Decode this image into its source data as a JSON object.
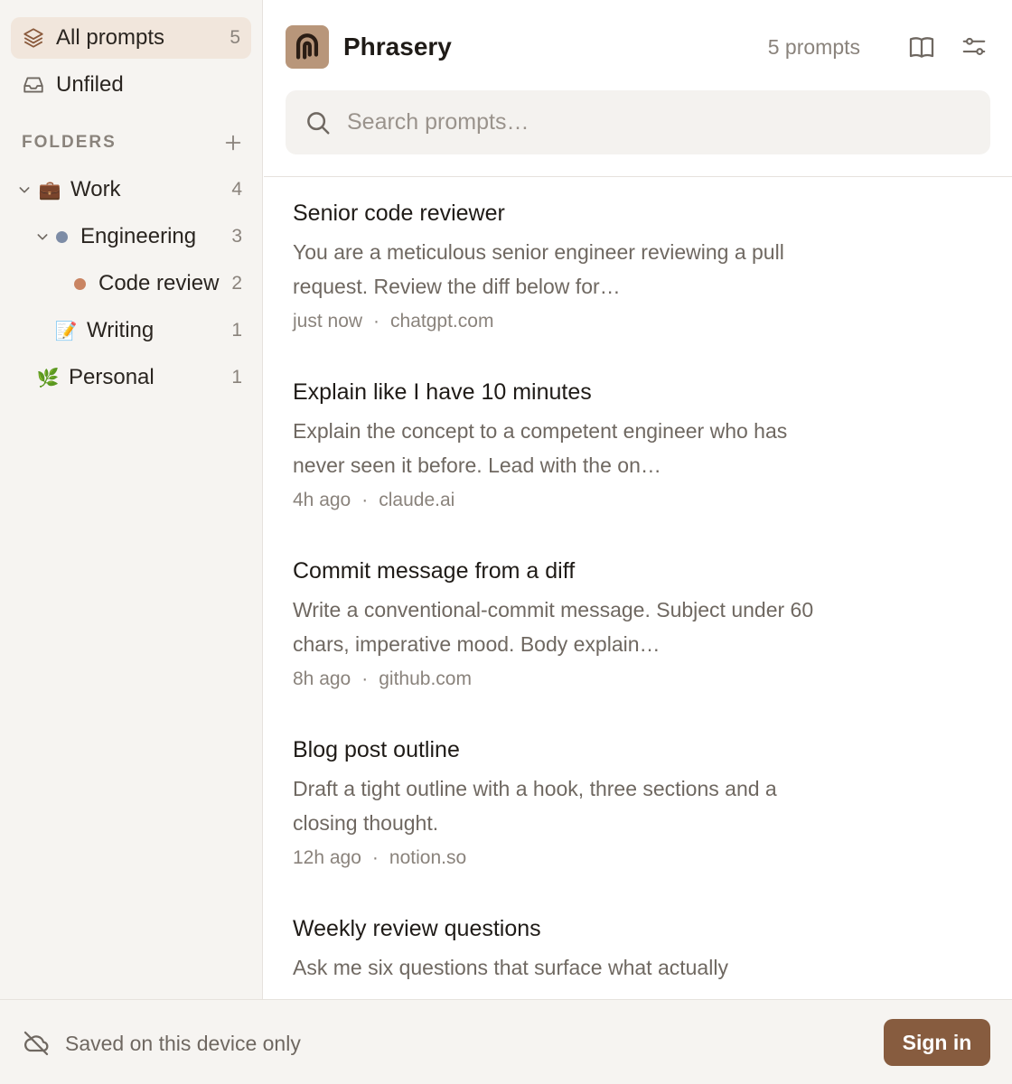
{
  "sidebar": {
    "all_prompts": {
      "label": "All prompts",
      "count": "5",
      "icon": "layers-icon"
    },
    "unfiled": {
      "label": "Unfiled",
      "icon": "inbox-icon"
    },
    "folders_label": "FOLDERS",
    "add_icon": "plus-icon",
    "folders": [
      {
        "label": "Work",
        "count": "4",
        "emoji": "💼",
        "expanded": true
      },
      {
        "label": "Engineering",
        "count": "3",
        "dot_color": "#7d8ca6",
        "expanded": true
      },
      {
        "label": "Code review",
        "count": "2",
        "dot_color": "#c98462"
      },
      {
        "label": "Writing",
        "count": "1",
        "emoji": "📝"
      },
      {
        "label": "Personal",
        "count": "1",
        "emoji": "🌿"
      }
    ]
  },
  "header": {
    "app_title": "Phrasery",
    "prompt_count": "5 prompts",
    "library_icon": "book-open-icon",
    "settings_icon": "sliders-icon"
  },
  "search": {
    "placeholder": "Search prompts…",
    "value": ""
  },
  "prompts": [
    {
      "title": "Senior code reviewer",
      "body": "You are a meticulous senior engineer reviewing a pull request. Review the diff below for…",
      "time": "just now",
      "source": "chatgpt.com"
    },
    {
      "title": "Explain like I have 10 minutes",
      "body": "Explain the concept to a competent engineer who has never seen it before. Lead with the on…",
      "time": "4h ago",
      "source": "claude.ai"
    },
    {
      "title": "Commit message from a diff",
      "body": "Write a conventional-commit message. Subject under 60 chars, imperative mood. Body explain…",
      "time": "8h ago",
      "source": "github.com"
    },
    {
      "title": "Blog post outline",
      "body": "Draft a tight outline with a hook, three sections and a closing thought.",
      "time": "12h ago",
      "source": "notion.so"
    },
    {
      "title": "Weekly review questions",
      "body": "Ask me six questions that surface what actually",
      "time": "",
      "source": ""
    }
  ],
  "meta_separator": "·",
  "footer": {
    "status": "Saved on this device only",
    "status_icon": "cloud-off-icon",
    "signin_label": "Sign in"
  },
  "colors": {
    "accent": "#875c3f",
    "active_bg": "#f1e6dc",
    "sidebar_bg": "#f6f4f1",
    "logo_bg": "#b8967a"
  }
}
